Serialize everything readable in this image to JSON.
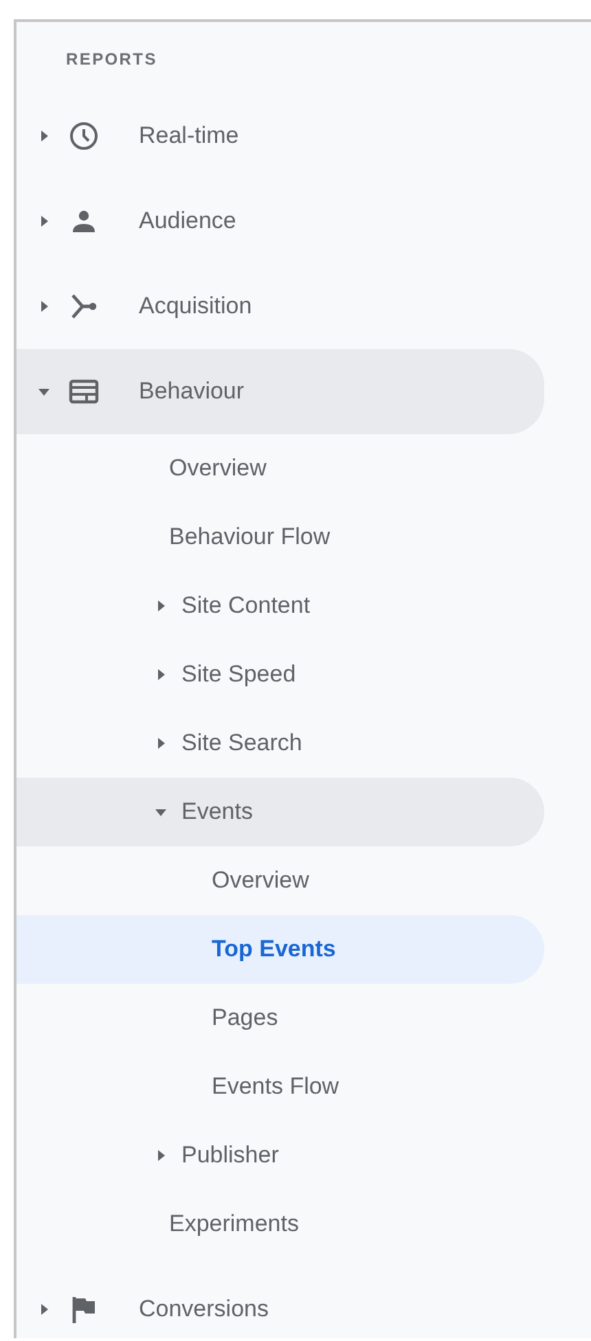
{
  "section_title": "REPORTS",
  "items": [
    {
      "label": "Real-time",
      "expanded": false,
      "selected": false
    },
    {
      "label": "Audience",
      "expanded": false,
      "selected": false
    },
    {
      "label": "Acquisition",
      "expanded": false,
      "selected": false
    },
    {
      "label": "Behaviour",
      "expanded": true,
      "selected": false,
      "children": [
        {
          "label": "Overview",
          "selected": false
        },
        {
          "label": "Behaviour Flow",
          "selected": false
        },
        {
          "label": "Site Content",
          "expanded": false,
          "selected": false
        },
        {
          "label": "Site Speed",
          "expanded": false,
          "selected": false
        },
        {
          "label": "Site Search",
          "expanded": false,
          "selected": false
        },
        {
          "label": "Events",
          "expanded": true,
          "selected": false,
          "children": [
            {
              "label": "Overview",
              "selected": false
            },
            {
              "label": "Top Events",
              "selected": true
            },
            {
              "label": "Pages",
              "selected": false
            },
            {
              "label": "Events Flow",
              "selected": false
            }
          ]
        },
        {
          "label": "Publisher",
          "expanded": false,
          "selected": false
        },
        {
          "label": "Experiments",
          "selected": false
        }
      ]
    },
    {
      "label": "Conversions",
      "expanded": false,
      "selected": false
    }
  ]
}
